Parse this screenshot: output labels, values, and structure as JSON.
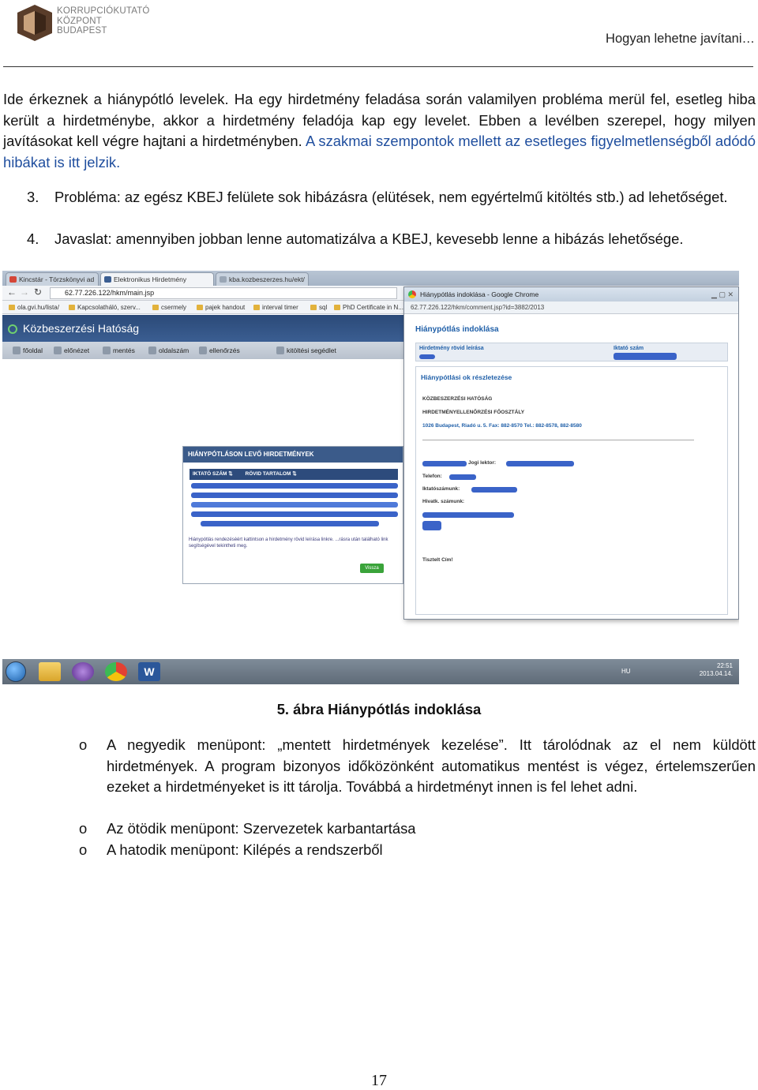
{
  "header": {
    "logo_lines": [
      "KORRUPCIÓKUTATÓ",
      "KÖZPONT",
      "BUDAPEST"
    ],
    "title": "Hogyan lehetne javítani…"
  },
  "intro": {
    "text_main": "Ide érkeznek a hiánypótló levelek. Ha egy hirdetmény feladása során valamilyen probléma merül fel, esetleg hiba került a hirdetménybe, akkor a hirdetmény feladója kap egy levelet. Ebben a levélben szerepel, hogy milyen javításokat kell végre hajtani a hirdetményben.",
    "text_blue": "A szakmai szempontok mellett az esetleges figyelmetlenségből adódó hibákat is itt jelzik."
  },
  "numbered": [
    {
      "n": "3.",
      "text": "Probléma: az egész KBEJ felülete sok hibázásra (elütések, nem egyértelmű kitöltés stb.) ad lehetőséget."
    },
    {
      "n": "4.",
      "text": "Javaslat: amennyiben jobban lenne automatizálva a KBEJ, kevesebb lenne a hibázás lehetősége."
    }
  ],
  "screenshot": {
    "tabs": [
      "Kincstár - Törzskönyvi ad",
      "Elektronikus Hirdetmény",
      "kba.kozbeszerzes.hu/ekt/"
    ],
    "url": "62.77.226.122/hkm/main.jsp",
    "bookmarks": [
      "ola.gvi.hu/lista/",
      "Kapcsolatháló, szerv...",
      "csermely",
      "pajek handout",
      "interval timer",
      "sql",
      "PhD Certificate in N..."
    ],
    "app_title": "Közbeszerzési Hatóság",
    "nav": [
      "főoldal",
      "előnézet",
      "mentés",
      "oldalszám",
      "ellenőrzés",
      "kitöltési segédlet"
    ],
    "panel": {
      "title": "HIÁNYPÓTLÁSON LEVŐ HIRDETMÉNYEK",
      "col1": "IKTATÓ SZÁM",
      "col2": "RÖVID TARTALOM",
      "note": "Hiánypótlás rendezéséért kattintson a hirdetmény rövid leírása linkre. ...rásra után található link segítségével tekintheti meg.",
      "button": "Vissza"
    },
    "popup": {
      "window_title": "Hiánypótlás indoklása - Google Chrome",
      "url": "62.77.226.122/hkm/comment.jsp?id=3882/2013",
      "heading": "Hiánypótlás indoklása",
      "field1": "Hirdetmény rövid leírása",
      "field2": "Iktató szám",
      "section": "Hiánypótlási ok részletezése",
      "org1": "KÖZBESZERZÉSI HATÓSÁG",
      "org2": "HIRDETMÉNYELLENŐRZÉSI FŐOSZTÁLY",
      "address": "1026 Budapest, Riadó u. 5. Fax: 882-8570 Tel.: 882-8578, 882-8580",
      "jogi": "Jogi lektor:",
      "telefon": "Telefon:",
      "iktato": "Iktatószámunk:",
      "hivatk": "Hivatk. számunk:",
      "greeting": "Tisztelt Cím!"
    },
    "tray": {
      "lang": "HU",
      "time": "22:51",
      "date": "2013.04.14."
    }
  },
  "caption": "5. ábra Hiánypótlás indoklása",
  "bullets": [
    "A negyedik menüpont: „mentett hirdetmények kezelése”. Itt tárolódnak az el nem küldött hirdetmények. A program bizonyos időközönként automatikus mentést is végez, értelemszerűen ezeket a hirdetményeket is itt tárolja. Továbbá a hirdetményt innen is fel lehet adni.",
    "Az ötödik menüpont: Szervezetek karbantartása",
    "A hatodik menüpont: Kilépés a rendszerből"
  ],
  "bullet_marker": "o",
  "page_number": "17"
}
